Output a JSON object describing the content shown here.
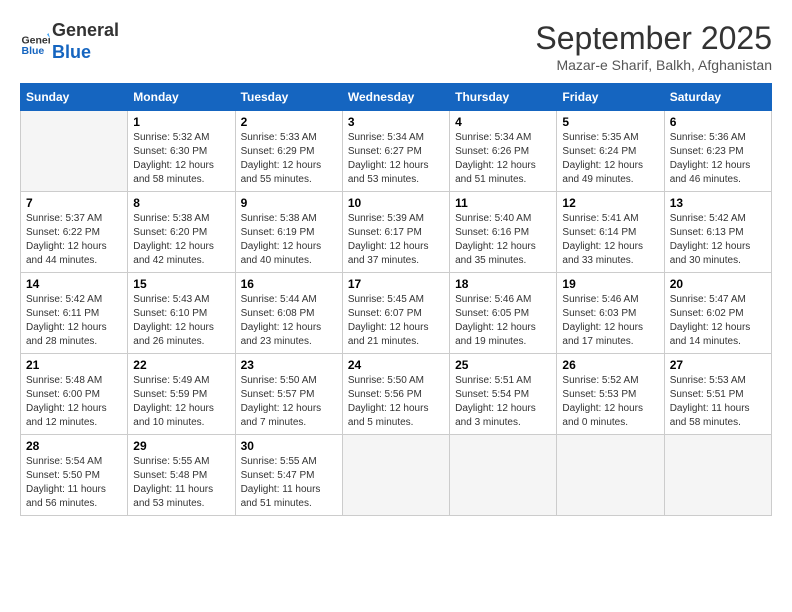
{
  "header": {
    "logo_line1": "General",
    "logo_line2": "Blue",
    "month_title": "September 2025",
    "subtitle": "Mazar-e Sharif, Balkh, Afghanistan"
  },
  "weekdays": [
    "Sunday",
    "Monday",
    "Tuesday",
    "Wednesday",
    "Thursday",
    "Friday",
    "Saturday"
  ],
  "weeks": [
    [
      {
        "day": "",
        "sunrise": "",
        "sunset": "",
        "daylight": ""
      },
      {
        "day": "1",
        "sunrise": "Sunrise: 5:32 AM",
        "sunset": "Sunset: 6:30 PM",
        "daylight": "Daylight: 12 hours and 58 minutes."
      },
      {
        "day": "2",
        "sunrise": "Sunrise: 5:33 AM",
        "sunset": "Sunset: 6:29 PM",
        "daylight": "Daylight: 12 hours and 55 minutes."
      },
      {
        "day": "3",
        "sunrise": "Sunrise: 5:34 AM",
        "sunset": "Sunset: 6:27 PM",
        "daylight": "Daylight: 12 hours and 53 minutes."
      },
      {
        "day": "4",
        "sunrise": "Sunrise: 5:34 AM",
        "sunset": "Sunset: 6:26 PM",
        "daylight": "Daylight: 12 hours and 51 minutes."
      },
      {
        "day": "5",
        "sunrise": "Sunrise: 5:35 AM",
        "sunset": "Sunset: 6:24 PM",
        "daylight": "Daylight: 12 hours and 49 minutes."
      },
      {
        "day": "6",
        "sunrise": "Sunrise: 5:36 AM",
        "sunset": "Sunset: 6:23 PM",
        "daylight": "Daylight: 12 hours and 46 minutes."
      }
    ],
    [
      {
        "day": "7",
        "sunrise": "Sunrise: 5:37 AM",
        "sunset": "Sunset: 6:22 PM",
        "daylight": "Daylight: 12 hours and 44 minutes."
      },
      {
        "day": "8",
        "sunrise": "Sunrise: 5:38 AM",
        "sunset": "Sunset: 6:20 PM",
        "daylight": "Daylight: 12 hours and 42 minutes."
      },
      {
        "day": "9",
        "sunrise": "Sunrise: 5:38 AM",
        "sunset": "Sunset: 6:19 PM",
        "daylight": "Daylight: 12 hours and 40 minutes."
      },
      {
        "day": "10",
        "sunrise": "Sunrise: 5:39 AM",
        "sunset": "Sunset: 6:17 PM",
        "daylight": "Daylight: 12 hours and 37 minutes."
      },
      {
        "day": "11",
        "sunrise": "Sunrise: 5:40 AM",
        "sunset": "Sunset: 6:16 PM",
        "daylight": "Daylight: 12 hours and 35 minutes."
      },
      {
        "day": "12",
        "sunrise": "Sunrise: 5:41 AM",
        "sunset": "Sunset: 6:14 PM",
        "daylight": "Daylight: 12 hours and 33 minutes."
      },
      {
        "day": "13",
        "sunrise": "Sunrise: 5:42 AM",
        "sunset": "Sunset: 6:13 PM",
        "daylight": "Daylight: 12 hours and 30 minutes."
      }
    ],
    [
      {
        "day": "14",
        "sunrise": "Sunrise: 5:42 AM",
        "sunset": "Sunset: 6:11 PM",
        "daylight": "Daylight: 12 hours and 28 minutes."
      },
      {
        "day": "15",
        "sunrise": "Sunrise: 5:43 AM",
        "sunset": "Sunset: 6:10 PM",
        "daylight": "Daylight: 12 hours and 26 minutes."
      },
      {
        "day": "16",
        "sunrise": "Sunrise: 5:44 AM",
        "sunset": "Sunset: 6:08 PM",
        "daylight": "Daylight: 12 hours and 23 minutes."
      },
      {
        "day": "17",
        "sunrise": "Sunrise: 5:45 AM",
        "sunset": "Sunset: 6:07 PM",
        "daylight": "Daylight: 12 hours and 21 minutes."
      },
      {
        "day": "18",
        "sunrise": "Sunrise: 5:46 AM",
        "sunset": "Sunset: 6:05 PM",
        "daylight": "Daylight: 12 hours and 19 minutes."
      },
      {
        "day": "19",
        "sunrise": "Sunrise: 5:46 AM",
        "sunset": "Sunset: 6:03 PM",
        "daylight": "Daylight: 12 hours and 17 minutes."
      },
      {
        "day": "20",
        "sunrise": "Sunrise: 5:47 AM",
        "sunset": "Sunset: 6:02 PM",
        "daylight": "Daylight: 12 hours and 14 minutes."
      }
    ],
    [
      {
        "day": "21",
        "sunrise": "Sunrise: 5:48 AM",
        "sunset": "Sunset: 6:00 PM",
        "daylight": "Daylight: 12 hours and 12 minutes."
      },
      {
        "day": "22",
        "sunrise": "Sunrise: 5:49 AM",
        "sunset": "Sunset: 5:59 PM",
        "daylight": "Daylight: 12 hours and 10 minutes."
      },
      {
        "day": "23",
        "sunrise": "Sunrise: 5:50 AM",
        "sunset": "Sunset: 5:57 PM",
        "daylight": "Daylight: 12 hours and 7 minutes."
      },
      {
        "day": "24",
        "sunrise": "Sunrise: 5:50 AM",
        "sunset": "Sunset: 5:56 PM",
        "daylight": "Daylight: 12 hours and 5 minutes."
      },
      {
        "day": "25",
        "sunrise": "Sunrise: 5:51 AM",
        "sunset": "Sunset: 5:54 PM",
        "daylight": "Daylight: 12 hours and 3 minutes."
      },
      {
        "day": "26",
        "sunrise": "Sunrise: 5:52 AM",
        "sunset": "Sunset: 5:53 PM",
        "daylight": "Daylight: 12 hours and 0 minutes."
      },
      {
        "day": "27",
        "sunrise": "Sunrise: 5:53 AM",
        "sunset": "Sunset: 5:51 PM",
        "daylight": "Daylight: 11 hours and 58 minutes."
      }
    ],
    [
      {
        "day": "28",
        "sunrise": "Sunrise: 5:54 AM",
        "sunset": "Sunset: 5:50 PM",
        "daylight": "Daylight: 11 hours and 56 minutes."
      },
      {
        "day": "29",
        "sunrise": "Sunrise: 5:55 AM",
        "sunset": "Sunset: 5:48 PM",
        "daylight": "Daylight: 11 hours and 53 minutes."
      },
      {
        "day": "30",
        "sunrise": "Sunrise: 5:55 AM",
        "sunset": "Sunset: 5:47 PM",
        "daylight": "Daylight: 11 hours and 51 minutes."
      },
      {
        "day": "",
        "sunrise": "",
        "sunset": "",
        "daylight": ""
      },
      {
        "day": "",
        "sunrise": "",
        "sunset": "",
        "daylight": ""
      },
      {
        "day": "",
        "sunrise": "",
        "sunset": "",
        "daylight": ""
      },
      {
        "day": "",
        "sunrise": "",
        "sunset": "",
        "daylight": ""
      }
    ]
  ]
}
